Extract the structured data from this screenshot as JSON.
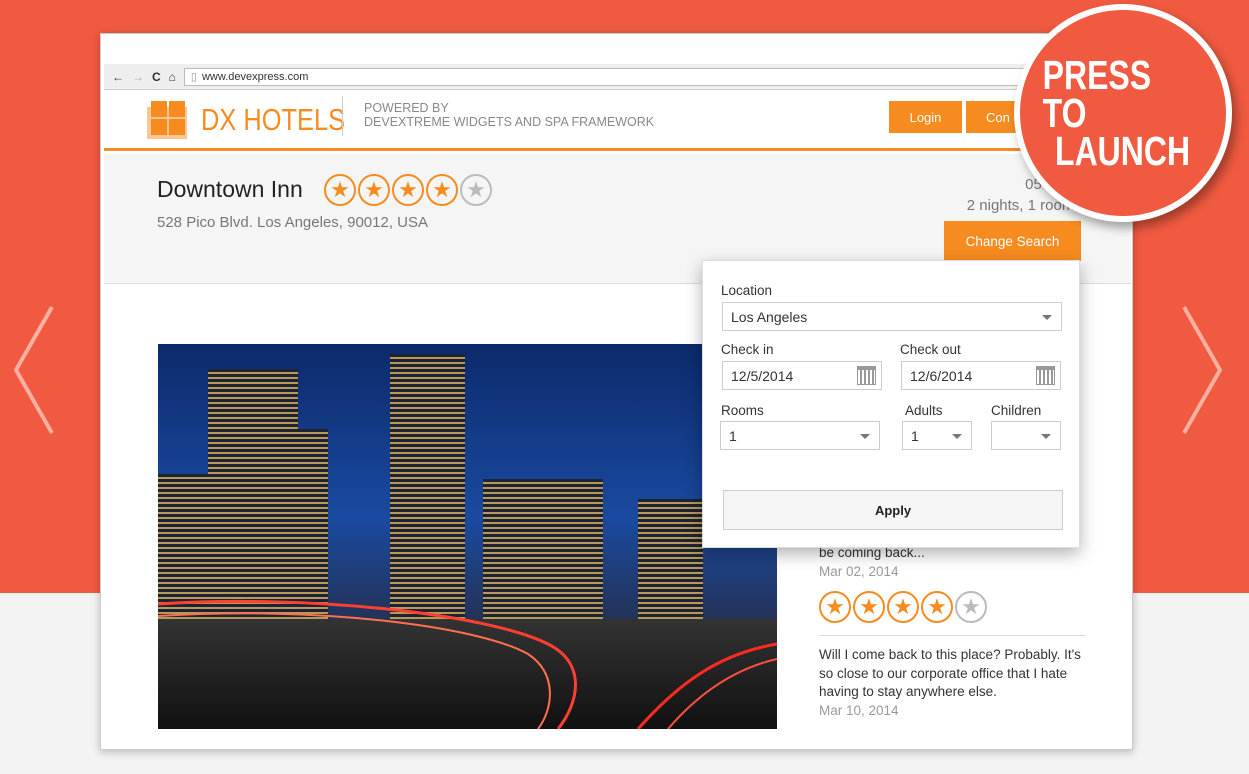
{
  "browser": {
    "url": "www.devexpress.com"
  },
  "header": {
    "logo": "DX HOTELS",
    "powered_line1": "POWERED BY",
    "powered_line2": "DEVEXTREME WIDGETS AND SPA FRAMEWORK",
    "login": "Login",
    "contact": "Con"
  },
  "hotel": {
    "name": "Downtown Inn",
    "address": "528 Pico Blvd. Los Angeles, 90012, USA",
    "rating": 4,
    "max_rating": 5,
    "dates": "05-07, De",
    "summary": "2 nights, 1 room, 1 ",
    "change_search": "Change Search"
  },
  "search": {
    "location_label": "Location",
    "location": "Los Angeles",
    "checkin_label": "Check in",
    "checkin": "12/5/2014",
    "checkout_label": "Check out",
    "checkout": "12/6/2014",
    "rooms_label": "Rooms",
    "rooms": "1",
    "adults_label": "Adults",
    "adults": "1",
    "children_label": "Children",
    "children": "",
    "apply": "Apply"
  },
  "reviews": [
    {
      "text": "be coming back...",
      "date": "Mar 02, 2014",
      "rating": 4
    },
    {
      "text": "Will I come back to this place? Probably. It's so close to our corporate office that I hate having to stay anywhere else.",
      "date": "Mar 10, 2014"
    }
  ],
  "promo": {
    "line1": "PRESS TO",
    "line2": "LAUNCH"
  },
  "colors": {
    "accent": "#f68b1f",
    "background": "#f05a40"
  }
}
